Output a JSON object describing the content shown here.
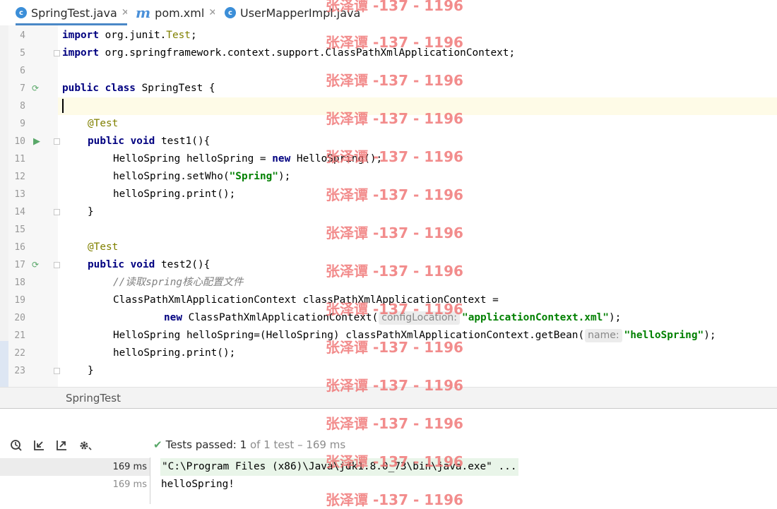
{
  "tabs": [
    {
      "label": "SpringTest.java",
      "icon": "java-class-icon",
      "active": true
    },
    {
      "label": "pom.xml",
      "icon": "maven-icon",
      "active": false
    },
    {
      "label": "UserMapperImpl.java",
      "icon": "java-class-icon",
      "active": false
    }
  ],
  "editor": {
    "line_numbers": [
      "4",
      "5",
      "6",
      "7",
      "8",
      "9",
      "10",
      "11",
      "12",
      "13",
      "14",
      "15",
      "16",
      "17",
      "18",
      "19",
      "20",
      "21",
      "22",
      "23"
    ],
    "lines": {
      "l4": {
        "kw": "import",
        "rest": " org.junit.",
        "cls": "Test",
        "end": ";"
      },
      "l5": {
        "kw": "import",
        "rest": " org.springframework.context.support.ClassPathXmlApplicationContext;"
      },
      "l7": {
        "kw": "public class",
        "rest": " SpringTest {"
      },
      "l9": {
        "ann": "@Test"
      },
      "l10": {
        "kw": "public void",
        "rest": " test1(){"
      },
      "l11": {
        "pre": "HelloSpring helloSpring = ",
        "kw": "new",
        "rest": " HelloSpring();"
      },
      "l12": {
        "pre": "helloSpring.setWho(",
        "str": "\"Spring\"",
        "end": ");"
      },
      "l13": {
        "text": "helloSpring.print();"
      },
      "l14": {
        "text": "}"
      },
      "l16": {
        "ann": "@Test"
      },
      "l17": {
        "kw": "public void",
        "rest": " test2(){"
      },
      "l18": {
        "cmt": "//读取spring核心配置文件"
      },
      "l19": {
        "text": "ClassPathXmlApplicationContext classPathXmlApplicationContext ="
      },
      "l20": {
        "kw": "new",
        "rest": " ClassPathXmlApplicationContext(",
        "hint": "configLocation:",
        "str": "\"applicationContext.xml\"",
        "end": ");"
      },
      "l21": {
        "pre": "HelloSpring helloSpring=(HelloSpring) classPathXmlApplicationContext.getBean(",
        "hint": "name:",
        "str": "\"helloSpring\"",
        "end": ");"
      },
      "l22": {
        "text": "helloSpring.print();"
      },
      "l23": {
        "text": "}"
      }
    }
  },
  "breadcrumb": "SpringTest",
  "run": {
    "toolbar_icons": [
      "history-icon",
      "import-tests-icon",
      "export-tests-icon",
      "settings-icon"
    ],
    "status": "Tests passed:",
    "passed": "1",
    "of_text": "of 1 test – 169 ms",
    "tree_times": [
      "169 ms",
      "169 ms"
    ],
    "output_lines": [
      "\"C:\\Program Files (x86)\\Java\\jdk1.8.0_73\\bin\\java.exe\" ...",
      "helloSpring!"
    ]
  },
  "watermark": "张泽谭 -137 - 1196",
  "colors": {
    "keyword": "#000080",
    "annotation": "#808000",
    "string": "#008000",
    "comment": "#808080",
    "caret_line": "#fefbe7",
    "passed_check": "#59a869"
  }
}
